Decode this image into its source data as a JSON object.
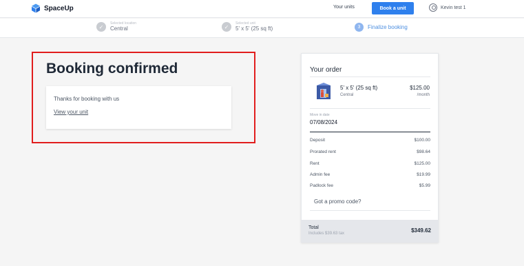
{
  "brand": {
    "name": "SpaceUp",
    "logo_icon": "cube-logo-icon",
    "logo_color": "#2f80ed"
  },
  "nav": {
    "your_units": "Your units",
    "book_unit": "Book a unit",
    "user_name": "Kevin test 1",
    "user_icon": "user-circle-icon"
  },
  "steps": [
    {
      "label": "Selected location",
      "value": "Central",
      "status": "done",
      "icon": "check-circle-icon"
    },
    {
      "label": "Selected unit",
      "value": "5' x 5' (25 sq ft)",
      "status": "done",
      "icon": "check-circle-icon"
    },
    {
      "number": "3",
      "value": "Finalize booking",
      "status": "active"
    }
  ],
  "confirmation": {
    "title": "Booking confirmed",
    "message": "Thanks for booking with us",
    "link": "View your unit",
    "highlight_color": "#e11d1d"
  },
  "order": {
    "title": "Your order",
    "unit": {
      "name": "5' x 5' (25 sq ft)",
      "location": "Central",
      "price": "$125.00",
      "period": "/month",
      "image_icon": "storage-unit-image"
    },
    "move_in_label": "Move in date",
    "move_in_date": "07/08/2024",
    "fees": [
      {
        "label": "Deposit",
        "amount": "$100.00"
      },
      {
        "label": "Prorated rent",
        "amount": "$98.64"
      },
      {
        "label": "Rent",
        "amount": "$125.00"
      },
      {
        "label": "Admin fee",
        "amount": "$19.99"
      },
      {
        "label": "Padlock fee",
        "amount": "$5.99"
      }
    ],
    "promo": "Got a promo code?",
    "total_label": "Total",
    "tax_note": "Includes $39.63 tax",
    "total_amount": "$349.62"
  }
}
